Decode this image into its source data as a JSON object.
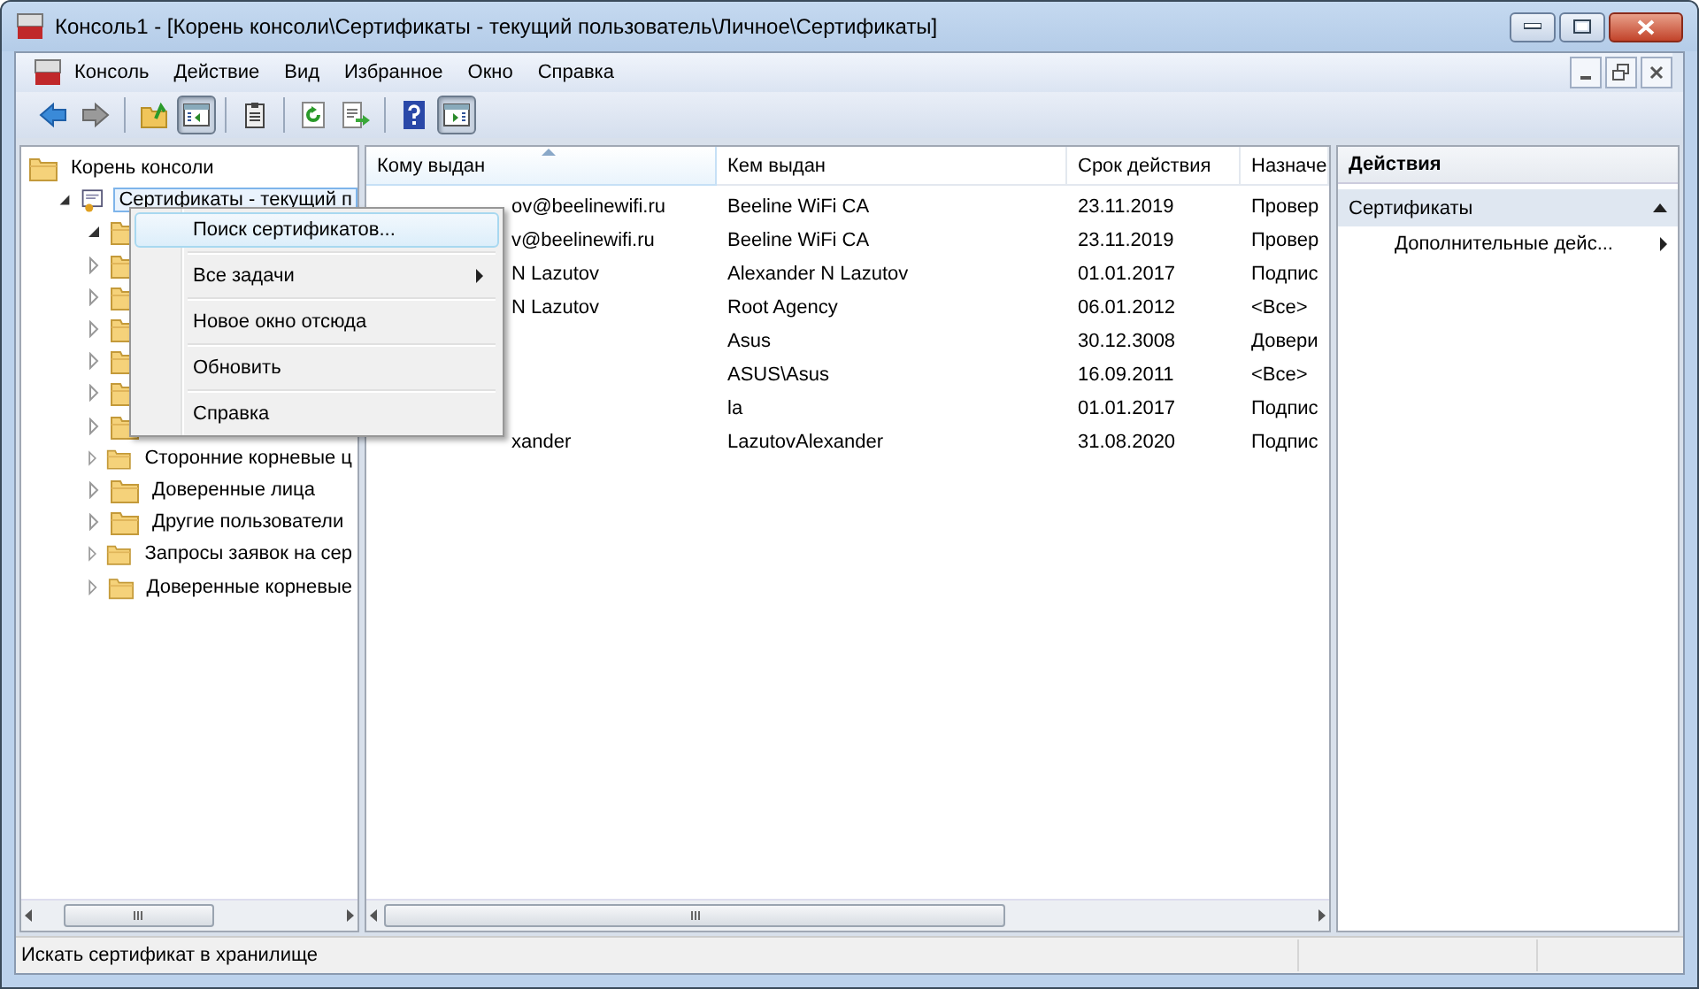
{
  "window": {
    "title": "Консоль1 - [Корень консоли\\Сертификаты - текущий пользователь\\Личное\\Сертификаты]"
  },
  "menu_bar": [
    "Консоль",
    "Действие",
    "Вид",
    "Избранное",
    "Окно",
    "Справка"
  ],
  "toolbar": [
    {
      "kind": "back",
      "pressed": false
    },
    {
      "kind": "forward",
      "pressed": false
    },
    {
      "kind": "sep"
    },
    {
      "kind": "up",
      "pressed": false
    },
    {
      "kind": "tree",
      "pressed": true
    },
    {
      "kind": "sep"
    },
    {
      "kind": "clipboard",
      "pressed": false
    },
    {
      "kind": "sep"
    },
    {
      "kind": "refresh",
      "pressed": false
    },
    {
      "kind": "export",
      "pressed": false
    },
    {
      "kind": "sep"
    },
    {
      "kind": "help",
      "pressed": false
    },
    {
      "kind": "actionpane",
      "pressed": true
    }
  ],
  "tree": [
    {
      "label": "Корень консоли",
      "kind": "folder",
      "children": [
        {
          "label": "Сертификаты - текущий п",
          "kind": "store",
          "expanded": true,
          "selected": true,
          "children": [
            {
              "kind": "folder",
              "expanded": true
            },
            {
              "kind": "folder",
              "expanded": false
            },
            {
              "kind": "folder",
              "expanded": false
            },
            {
              "kind": "folder",
              "expanded": false
            },
            {
              "kind": "folder",
              "expanded": false
            },
            {
              "kind": "folder",
              "expanded": false
            },
            {
              "kind": "folder",
              "expanded": false
            },
            {
              "label": "Сторонние корневые ц",
              "kind": "folder",
              "expanded": false
            },
            {
              "label": "Доверенные лица",
              "kind": "folder",
              "expanded": false
            },
            {
              "label": "Другие пользователи",
              "kind": "folder",
              "expanded": false
            },
            {
              "label": "Запросы заявок на сер",
              "kind": "folder",
              "expanded": false
            },
            {
              "label": "Доверенные корневые",
              "kind": "folder",
              "expanded": false
            }
          ]
        }
      ]
    }
  ],
  "list": {
    "columns": [
      {
        "label": "Кому выдан",
        "sorted": true
      },
      {
        "label": "Кем выдан",
        "sorted": false
      },
      {
        "label": "Срок действия",
        "sorted": false
      },
      {
        "label": "Назначе",
        "sorted": false
      }
    ],
    "rows": [
      [
        "ov@beelinewifi.ru",
        "Beeline WiFi CA",
        "23.11.2019",
        "Провер"
      ],
      [
        "v@beelinewifi.ru",
        "Beeline WiFi CA",
        "23.11.2019",
        "Провер"
      ],
      [
        "N Lazutov",
        "Alexander N Lazutov",
        "01.01.2017",
        "Подпис"
      ],
      [
        "N Lazutov",
        "Root Agency",
        "06.01.2012",
        "<Все>"
      ],
      [
        null,
        "Asus",
        "30.12.3008",
        "Довери"
      ],
      [
        null,
        "ASUS\\Asus",
        "16.09.2011",
        "<Все>"
      ],
      [
        null,
        "la",
        "01.01.2017",
        "Подпис"
      ],
      [
        "xander",
        "LazutovAlexander",
        "31.08.2020",
        "Подпис"
      ]
    ]
  },
  "actions": {
    "title": "Действия",
    "sections": [
      {
        "label": "Сертификаты",
        "expanded": true,
        "items": [
          "Дополнительные дейс..."
        ]
      }
    ]
  },
  "context_menu": [
    {
      "label": "Поиск сертификатов...",
      "kind": "plain",
      "selected": true
    },
    {
      "label": "Все задачи",
      "kind": "submenu",
      "selected": false
    },
    {
      "label": "Новое окно отсюда",
      "kind": "plain",
      "selected": false
    },
    {
      "label": "Обновить",
      "kind": "plain",
      "selected": false
    },
    {
      "label": "Справка",
      "kind": "plain",
      "selected": false
    }
  ],
  "status_bar": {
    "text": "Искать сертификат в хранилище"
  }
}
